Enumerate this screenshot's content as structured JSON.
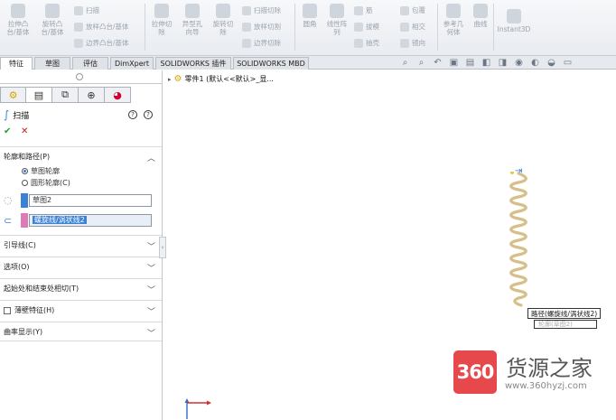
{
  "ribbon": {
    "extrude_boss": "拉伸凸\n台/基体",
    "revolve_boss": "旋转凸\n台/基体",
    "sweep": "扫描",
    "loft_boss": "放样凸台/基体",
    "boundary_boss": "边界凸台/基体",
    "extrude_cut": "拉伸切\n除",
    "hole_wizard": "异型孔\n向导",
    "revolve_cut": "旋转切\n除",
    "swept_cut": "扫描切除",
    "lofted_cut": "放样切割",
    "boundary_cut": "边界切除",
    "fillet": "圆角",
    "linear_pattern": "线性阵\n列",
    "rib": "筋",
    "draft": "拔模",
    "shell": "抽壳",
    "wrap": "包覆",
    "intersect": "相交",
    "mirror": "镜向",
    "reference_geometry": "参考几\n何体",
    "curves": "曲线",
    "instant3d": "Instant3D"
  },
  "tabs": [
    "特征",
    "草图",
    "评估",
    "DimXpert",
    "SOLIDWORKS 插件",
    "SOLIDWORKS MBD"
  ],
  "feature_tree": {
    "part_label": "零件1 (默认<<默认>_显..."
  },
  "property_manager": {
    "title": "扫描",
    "help_glyph": "?",
    "ok_glyph": "✔",
    "cancel_glyph": "✕",
    "profile_path": {
      "header": "轮廓和路径(P)",
      "option_sketch_profile": "草图轮廓",
      "option_circular_profile": "圆形轮廓(C)",
      "profile_value": "草图2",
      "path_value": "螺旋线/涡状线2"
    },
    "sections": {
      "guide_curves": "引导线(C)",
      "options": "选项(O)",
      "tangency": "起始处和结束处相切(T)",
      "thin_feature": "薄壁特征(H)",
      "curvature_display": "曲率显示(Y)"
    }
  },
  "viewport": {
    "callout_path": "路径(螺旋线/涡状线2)",
    "callout_profile": "轮廓(草图2)"
  },
  "watermark": {
    "logo": "360",
    "brand": "货源之家",
    "url": "www.360hyzj.com"
  },
  "colors": {
    "accent_blue": "#3b82d6",
    "selection_pink": "#e07ab4",
    "coil_tan": "#d6bf8a",
    "watermark_red": "#e4393c"
  }
}
